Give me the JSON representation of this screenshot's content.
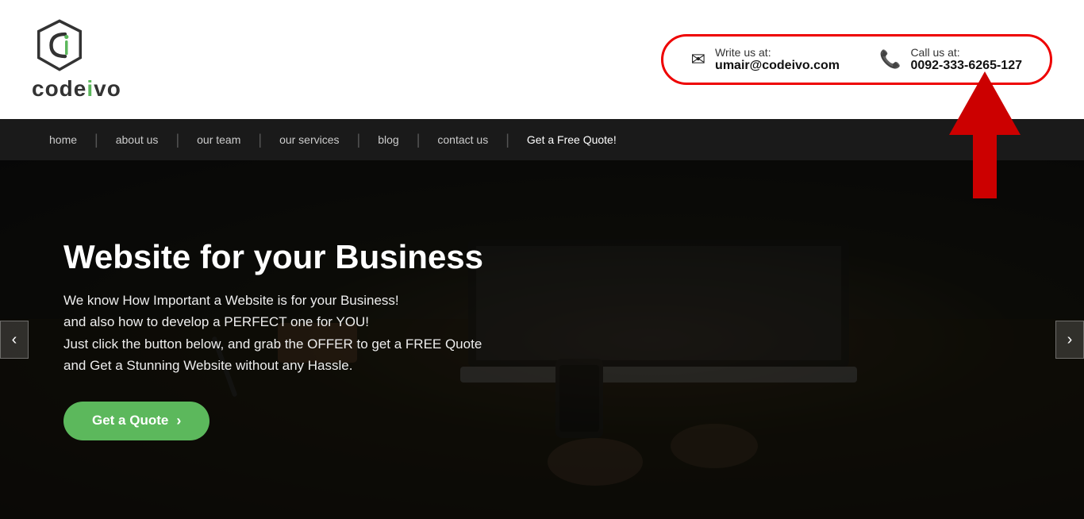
{
  "header": {
    "logo_text_start": "code",
    "logo_text_highlight": "i",
    "logo_text_end": "vo",
    "contact": {
      "email_label": "Write us at:",
      "email_value": "umair@codeivo.com",
      "phone_label": "Call us at:",
      "phone_value": "0092-333-6265-127"
    }
  },
  "navbar": {
    "items": [
      {
        "label": "home",
        "href": "#"
      },
      {
        "label": "about us",
        "href": "#"
      },
      {
        "label": "our team",
        "href": "#"
      },
      {
        "label": "our services",
        "href": "#"
      },
      {
        "label": "blog",
        "href": "#"
      },
      {
        "label": "contact us",
        "href": "#"
      },
      {
        "label": "Get a Free Quote!",
        "href": "#",
        "class": "btn-quote"
      }
    ]
  },
  "hero": {
    "title": "Website for your Business",
    "body_line1": "We know How Important a Website is for your Business!",
    "body_line2": "and also how to develop a PERFECT one for YOU!",
    "body_line3": "Just click the button below, and grab the OFFER to get a FREE Quote",
    "body_line4": "and Get a Stunning Website without any Hassle.",
    "cta_label": "Get a Quote",
    "prev_label": "‹",
    "next_label": "›"
  }
}
